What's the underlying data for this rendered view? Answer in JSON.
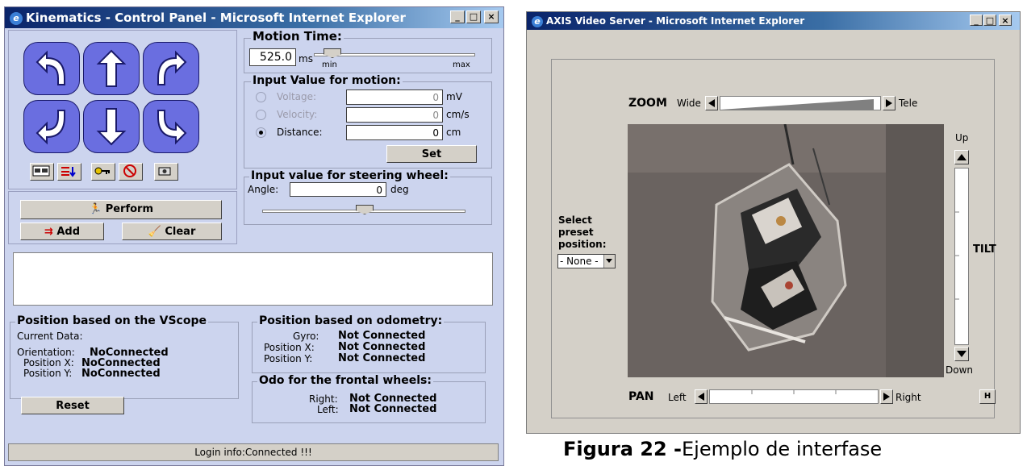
{
  "window1": {
    "title": "Kinematics - Control Panel - Microsoft Internet Explorer",
    "motion_time": {
      "title": "Motion Time:",
      "value": "525.0",
      "unit": "ms",
      "slider_min": "min",
      "slider_max": "max"
    },
    "input_value": {
      "title": "Input Value for motion:",
      "voltage": {
        "label": "Voltage:",
        "value": "0",
        "unit": "mV"
      },
      "velocity": {
        "label": "Velocity:",
        "value": "0",
        "unit": "cm/s"
      },
      "distance": {
        "label": "Distance:",
        "value": "0",
        "unit": "cm",
        "selected": true
      },
      "set_label": "Set"
    },
    "steering": {
      "title": "Input value for steering wheel:",
      "angle_label": "Angle:",
      "angle_value": "0",
      "unit": "deg"
    },
    "perform_label": "Perform",
    "add_label": "Add",
    "clear_label": "Clear",
    "vscope": {
      "title": "Position based on the VScope",
      "current_data": "Current Data:",
      "orientation_label": "Orientation:",
      "orientation_value": "NoConnected",
      "pos_x_label": "Position X:",
      "pos_x_value": "NoConnected",
      "pos_y_label": "Position Y:",
      "pos_y_value": "NoConnected",
      "reset_label": "Reset"
    },
    "odometry": {
      "title": "Position based on odometry:",
      "gyro_label": "Gyro:",
      "gyro_value": "Not Connected",
      "pos_x_label": "Position X:",
      "pos_x_value": "Not Connected",
      "pos_y_label": "Position Y:",
      "pos_y_value": "Not Connected"
    },
    "frontal": {
      "title": "Odo for the frontal wheels:",
      "right_label": "Right:",
      "right_value": "Not Connected",
      "left_label": "Left:",
      "left_value": "Not Connected"
    },
    "status": "Login info:Connected !!!"
  },
  "window2": {
    "title": "AXIS Video Server - Microsoft Internet Explorer",
    "zoom_label": "ZOOM",
    "zoom_wide": "Wide",
    "zoom_tele": "Tele",
    "up_label": "Up",
    "down_label": "Down",
    "tilt_label": "TILT",
    "pan_label": "PAN",
    "pan_left": "Left",
    "pan_right": "Right",
    "home_label": "H",
    "preset_label_1": "Select",
    "preset_label_2": "preset",
    "preset_label_3": "position:",
    "preset_value": "- None -"
  },
  "caption": {
    "bold": "Figura 22 -",
    "rest": "Ejemplo de interfase"
  },
  "colors": {
    "panel": "#ccd4ee",
    "arrow_button": "#6a6ee0",
    "titlebar": "#0a246a",
    "ie_grey": "#d4d0c8"
  },
  "icons": [
    "ie-logo-icon",
    "arrow-turn-left-icon",
    "arrow-up-icon",
    "arrow-turn-right-icon",
    "arrow-back-left-icon",
    "arrow-down-icon",
    "arrow-back-right-icon",
    "runner-icon",
    "broom-icon",
    "add-list-icon"
  ]
}
